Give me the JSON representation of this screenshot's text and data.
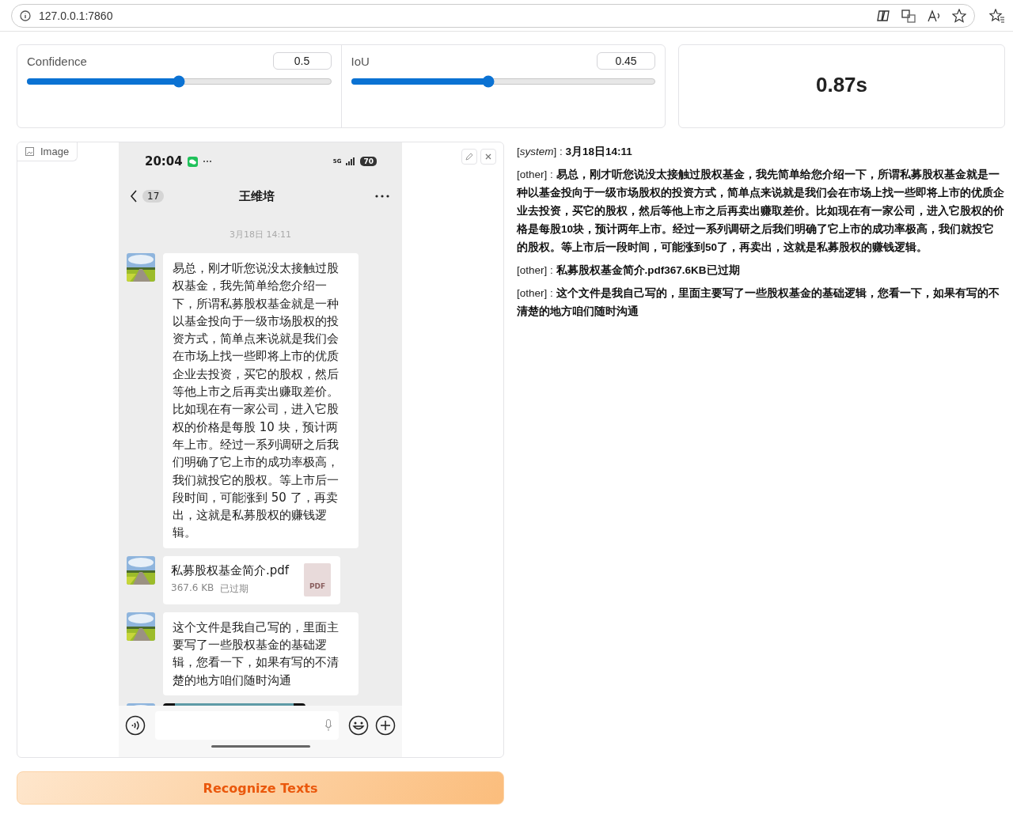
{
  "browser": {
    "url": "127.0.0.1:7860"
  },
  "sliders": [
    {
      "label": "Confidence",
      "value": "0.5",
      "level": 0.5
    },
    {
      "label": "IoU",
      "value": "0.45",
      "level": 0.45
    }
  ],
  "timing": "0.87s",
  "image_panel": {
    "label": "Image",
    "screenshot": {
      "time": "20:04",
      "network": "5G",
      "battery": "70",
      "unread": "17",
      "contact": "王维培",
      "date": "3月18日 14:11",
      "messages": [
        {
          "kind": "text",
          "text": "易总，刚才听您说没太接触过股权基金，我先简单给您介绍一下，所谓私募股权基金就是一种以基金投向于一级市场股权的投资方式，简单点来说就是我们会在市场上找一些即将上市的优质企业去投资，买它的股权，然后等他上市之后再卖出赚取差价。比如现在有一家公司，进入它股权的价格是每股 10 块，预计两年上市。经过一系列调研之后我们明确了它上市的成功率极高，我们就投它的股权。等上市后一段时间，可能涨到 50 了，再卖出，这就是私募股权的赚钱逻辑。"
        },
        {
          "kind": "file",
          "name": "私募股权基金简介.pdf",
          "size": "367.6 KB",
          "status": "已过期",
          "icon_label": "PDF"
        },
        {
          "kind": "text",
          "text": "这个文件是我自己写的，里面主要写了一些股权基金的基础逻辑，您看一下，如果有写的不清楚的地方咱们随时沟通"
        },
        {
          "kind": "picture"
        }
      ]
    }
  },
  "button": "Recognize Texts",
  "results": [
    "[*system*] : **3月18日14:11**",
    "[other] : **易总，刚才听您说没太接触过股权基金，我先简单给您介绍一下，所谓私募股权基金就是一种以基金投向于一级市场股权的投资方式，简单点来说就是我们会在市场上找一些即将上市的优质企业去投资，买它的股权，然后等他上市之后再卖出赚取差价。比如现在有一家公司，进入它股权的价格是每股10块，预计两年上市。经过一系列调研之后我们明确了它上市的成功率极高，我们就投它的股权。等上市后一段时间，可能涨到50了，再卖出，这就是私募股权的赚钱逻辑。**",
    "[other] : **私募股权基金简介.pdf367.6KB已过期**",
    "[other] : **这个文件是我自己写的，里面主要写了一些股权基金的基础逻辑，您看一下，如果有写的不清楚的地方咱们随时沟通**"
  ]
}
